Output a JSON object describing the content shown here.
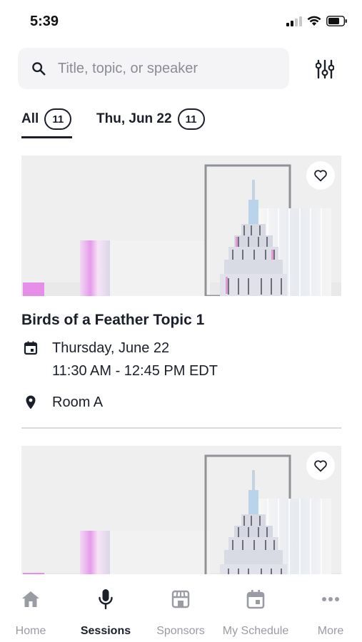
{
  "status_bar": {
    "time": "5:39"
  },
  "search": {
    "placeholder": "Title, topic, or speaker",
    "value": ""
  },
  "tabs": [
    {
      "label": "All",
      "count": "11",
      "selected": true
    },
    {
      "label": "Thu, Jun 22",
      "count": "11",
      "selected": false
    }
  ],
  "sessions": [
    {
      "title": "Birds of a Feather Topic 1",
      "date": "Thursday, June 22",
      "time": "11:30 AM - 12:45 PM EDT",
      "location": "Room A",
      "favorite": false
    },
    {
      "title": "",
      "favorite": false
    }
  ],
  "bottom_nav": [
    {
      "label": "Home",
      "icon": "home-icon",
      "active": false
    },
    {
      "label": "Sessions",
      "icon": "microphone-icon",
      "active": true
    },
    {
      "label": "Sponsors",
      "icon": "storefront-icon",
      "active": false
    },
    {
      "label": "My Schedule",
      "icon": "calendar-icon",
      "active": false
    },
    {
      "label": "More",
      "icon": "more-dots-icon",
      "active": false
    }
  ],
  "colors": {
    "text": "#1b1f2a",
    "inactive": "#9a9ca3",
    "search_bg": "#f4f4f6",
    "divider": "#dcdcdf"
  }
}
